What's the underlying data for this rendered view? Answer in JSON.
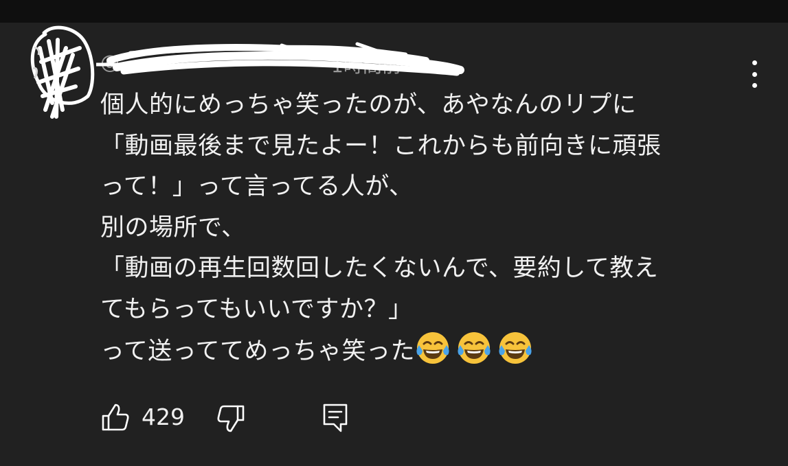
{
  "header": {
    "handle": "@",
    "time": "1時間前"
  },
  "menu": {
    "icon": "more-vertical-icon"
  },
  "comment": {
    "lines": [
      "個人的にめっちゃ笑ったのが、あやなんのリプに",
      "「動画最後まで見たよー！これからも前向きに頑張",
      "って！」って言ってる人が、",
      "別の場所で、",
      "「動画の再生回数回したくないんで、要約して教え",
      "てもらってもいいですか？」",
      "って送っててめっちゃ笑った"
    ],
    "emoji": [
      "face-with-tears-of-joy",
      "face-with-tears-of-joy",
      "face-with-tears-of-joy"
    ]
  },
  "actions": {
    "like_icon": "thumbs-up-icon",
    "like_count": "429",
    "dislike_icon": "thumbs-down-icon",
    "reply_icon": "reply-comment-icon"
  },
  "colors": {
    "background": "#212121",
    "text": "#f1f1f1",
    "meta": "#9a9a9a",
    "emoji_face": "#f7c33b"
  }
}
